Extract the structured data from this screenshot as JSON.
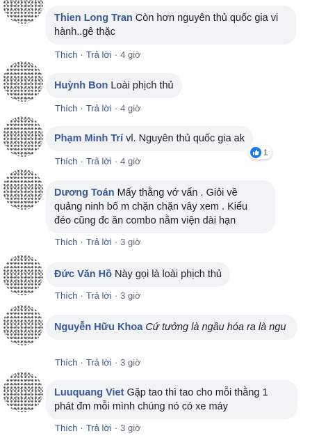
{
  "comments": [
    {
      "author": "Thien Long Tran",
      "text": "Còn hơn nguyên thủ quốc gia vi hành..gê thặc",
      "like": "Thích",
      "reply": "Trả lời",
      "time": "4 giờ"
    },
    {
      "author": "Huỳnh Bon",
      "text": "Loài phịch thủ",
      "like": "Thích",
      "reply": "Trả lời",
      "time": "4 giờ"
    },
    {
      "author": "Phạm Minh Trí",
      "text": "vl. Nguyên thủ quốc gia ak",
      "like": "Thích",
      "reply": "Trả lời",
      "time": "4 giờ",
      "reaction_count": "1",
      "reaction_icon": "like-icon",
      "reaction_color": "#1877f2"
    },
    {
      "author": "Dương Toán",
      "text": "Mấy thằng vớ vẩn . Giỏi về quảng ninh bố m chặn chặn vây xem . Kiểu đéo cũng đc ăn combo nằm viện dài hạn",
      "like": "Thích",
      "reply": "Trả lời",
      "time": "3 giờ"
    },
    {
      "author": "Đức Văn Hồ",
      "text": "Này gọi là loài phịch thủ",
      "like": "Thích",
      "reply": "Trả lời",
      "time": "3 giờ"
    },
    {
      "author": "Nguyễn Hữu Khoa",
      "text": "Cứ tưởng là ngầu hóa ra là ngu",
      "like": "Thích",
      "reply": "Trả lời",
      "time": "3 giờ"
    },
    {
      "author": "Luuquang Viet",
      "text": "Gặp tao thì tao cho mỗi thằng 1 phát đm mỗi mình chúng nó có xe máy",
      "like": "Thích",
      "reply": "Trả lời",
      "time": "3 giờ"
    }
  ],
  "colors": {
    "author": "#385898",
    "bubble": "#f2f3f5",
    "meta": "#606770"
  }
}
